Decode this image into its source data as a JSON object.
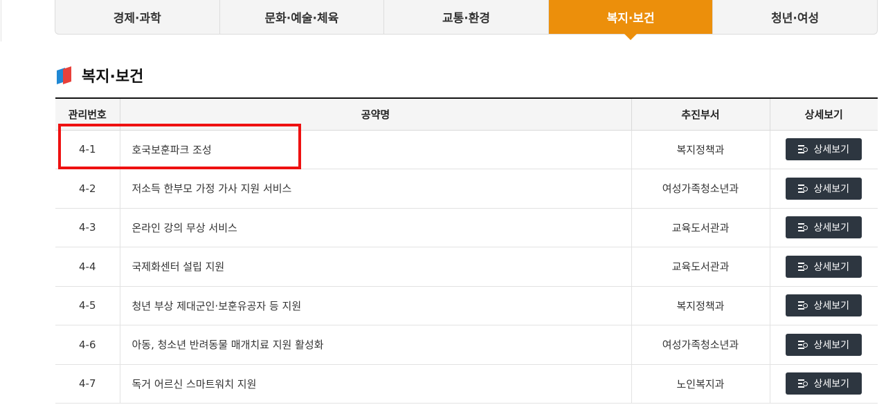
{
  "tabs": [
    {
      "label": "경제·과학",
      "active": false
    },
    {
      "label": "문화·예술·체육",
      "active": false
    },
    {
      "label": "교통·환경",
      "active": false
    },
    {
      "label": "복지·보건",
      "active": true
    },
    {
      "label": "청년·여성",
      "active": false
    }
  ],
  "section": {
    "title": "복지·보건"
  },
  "table": {
    "headers": {
      "no": "관리번호",
      "name": "공약명",
      "dept": "추진부서",
      "view": "상세보기"
    },
    "button_label": "상세보기",
    "rows": [
      {
        "no": "4-1",
        "name": "호국보훈파크 조성",
        "dept": "복지정책과"
      },
      {
        "no": "4-2",
        "name": "저소득 한부모 가정 가사 지원 서비스",
        "dept": "여성가족청소년과"
      },
      {
        "no": "4-3",
        "name": "온라인 강의 무상 서비스",
        "dept": "교육도서관과"
      },
      {
        "no": "4-4",
        "name": "국제화센터 설립 지원",
        "dept": "교육도서관과"
      },
      {
        "no": "4-5",
        "name": "청년 부상 제대군인·보훈유공자 등 지원",
        "dept": "복지정책과"
      },
      {
        "no": "4-6",
        "name": "아동, 청소년 반려동물 매개치료 지원 활성화",
        "dept": "여성가족청소년과"
      },
      {
        "no": "4-7",
        "name": "독거 어르신 스마트워치 지원",
        "dept": "노인복지과"
      }
    ]
  },
  "colors": {
    "accent": "#ec8f0b",
    "button_bg": "#2d3640",
    "highlight": "#ee1111"
  }
}
